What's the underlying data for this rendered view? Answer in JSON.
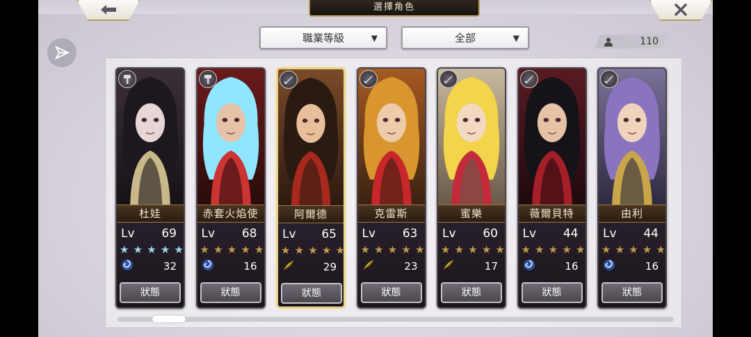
{
  "header": {
    "title": "選擇角色",
    "back_icon": "back-arrow-icon",
    "close_icon": "close-x-icon"
  },
  "filters": {
    "class_level": "職業等級",
    "all": "全部"
  },
  "roster": {
    "count": "110"
  },
  "colors": {
    "star_white": "#dfe9f5",
    "star_gold": "#c59a4a",
    "star_cyan": "#9fd8f0",
    "selected_border": "#e9d48a"
  },
  "characters": [
    {
      "name": "杜娃",
      "lv_label": "Lv",
      "level": "69",
      "stars": 5,
      "star_style": "cyan",
      "skill_icon": "swirl-icon",
      "skill_value": "32",
      "status_label": "狀態",
      "class_icon": "hammer-icon",
      "selected": false
    },
    {
      "name": "赤套火焰使",
      "lv_label": "Lv",
      "level": "68",
      "stars": 5,
      "star_style": "gold",
      "skill_icon": "swirl-icon",
      "skill_value": "16",
      "status_label": "狀態",
      "class_icon": "hammer-icon",
      "selected": false
    },
    {
      "name": "阿爾德",
      "lv_label": "Lv",
      "level": "65",
      "stars": 5,
      "star_style": "gold",
      "skill_icon": "feather-icon",
      "skill_value": "29",
      "status_label": "狀態",
      "class_icon": "sword-icon",
      "selected": true
    },
    {
      "name": "克雷斯",
      "lv_label": "Lv",
      "level": "63",
      "stars": 5,
      "star_style": "gold",
      "skill_icon": "feather-icon",
      "skill_value": "23",
      "status_label": "狀態",
      "class_icon": "sword-icon",
      "selected": false
    },
    {
      "name": "蜜樂",
      "lv_label": "Lv",
      "level": "60",
      "stars": 5,
      "star_style": "gold",
      "skill_icon": "feather-icon",
      "skill_value": "17",
      "status_label": "狀態",
      "class_icon": "sword-icon",
      "selected": false
    },
    {
      "name": "薇爾貝特",
      "lv_label": "Lv",
      "level": "44",
      "stars": 5,
      "star_style": "gold",
      "skill_icon": "swirl-icon",
      "skill_value": "16",
      "status_label": "狀態",
      "class_icon": "sword-icon",
      "selected": false
    },
    {
      "name": "由利",
      "lv_label": "Lv",
      "level": "44",
      "stars": 5,
      "star_style": "gold",
      "skill_icon": "swirl-icon",
      "skill_value": "16",
      "status_label": "狀態",
      "class_icon": "sword-icon",
      "selected": false
    }
  ]
}
